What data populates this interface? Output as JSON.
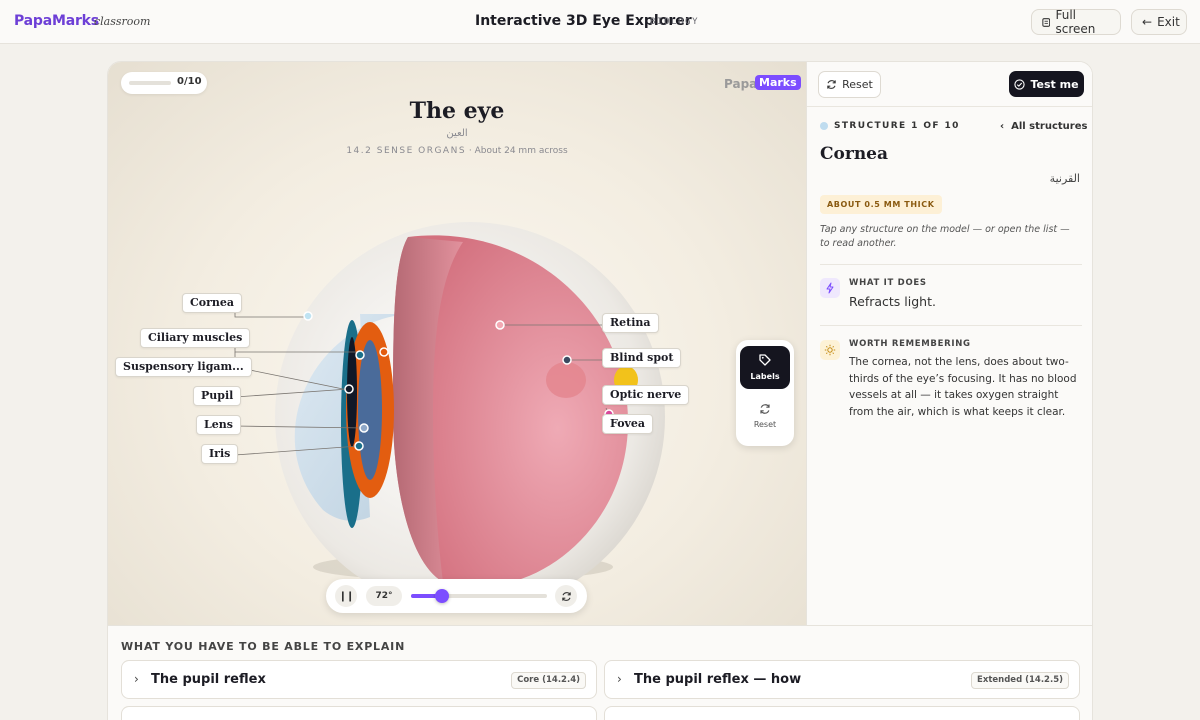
{
  "header": {
    "brand": "PapaMarks",
    "brand_sub": "classroom",
    "title": "Interactive 3D Eye Explorer",
    "subject_tag": "BIOLOGY",
    "fullscreen_label": "Full screen",
    "exit_label": "Exit"
  },
  "viewer": {
    "progress_label": "0/10",
    "progress_fraction": 0,
    "logo_prefix": "Papa",
    "logo_badge": "Marks",
    "title": "The eye",
    "title_ar": "العين",
    "section_code": "14.2 SENSE ORGANS",
    "size_note": "· About 24 mm across",
    "labels": {
      "cornea": "Cornea",
      "ciliary": "Ciliary muscles",
      "suspensory": "Suspensory ligam...",
      "pupil": "Pupil",
      "lens": "Lens",
      "iris": "Iris",
      "retina": "Retina",
      "blind_spot": "Blind spot",
      "optic_nerve": "Optic nerve",
      "fovea": "Fovea"
    },
    "player": {
      "angle_label": "72°",
      "rotation_fraction": 0.23
    },
    "tools": {
      "labels_label": "Labels",
      "reset_label": "Reset"
    }
  },
  "panel": {
    "reset_label": "Reset",
    "test_label": "Test me",
    "structure_count": "STRUCTURE 1 OF 10",
    "all_structures": "All structures",
    "structure_name": "Cornea",
    "structure_name_ar": "القرنية",
    "fact_badge": "ABOUT 0.5 MM THICK",
    "hint": "Tap any structure on the model — or open the list — to read another.",
    "what_it_does": {
      "heading": "WHAT IT DOES",
      "body": "Refracts light."
    },
    "worth_remembering": {
      "heading": "WORTH REMEMBERING",
      "body": "The cornea, not the lens, does about two-thirds of the eye’s focusing. It has no blood vessels at all — it takes oxygen straight from the air, which is what keeps it clear."
    }
  },
  "explain": {
    "title": "WHAT YOU HAVE TO BE ABLE TO EXPLAIN",
    "items": [
      {
        "title": "The pupil reflex",
        "badge": "Core (14.2.4)"
      },
      {
        "title": "The pupil reflex — how",
        "badge": "Extended (14.2.5)"
      }
    ]
  }
}
